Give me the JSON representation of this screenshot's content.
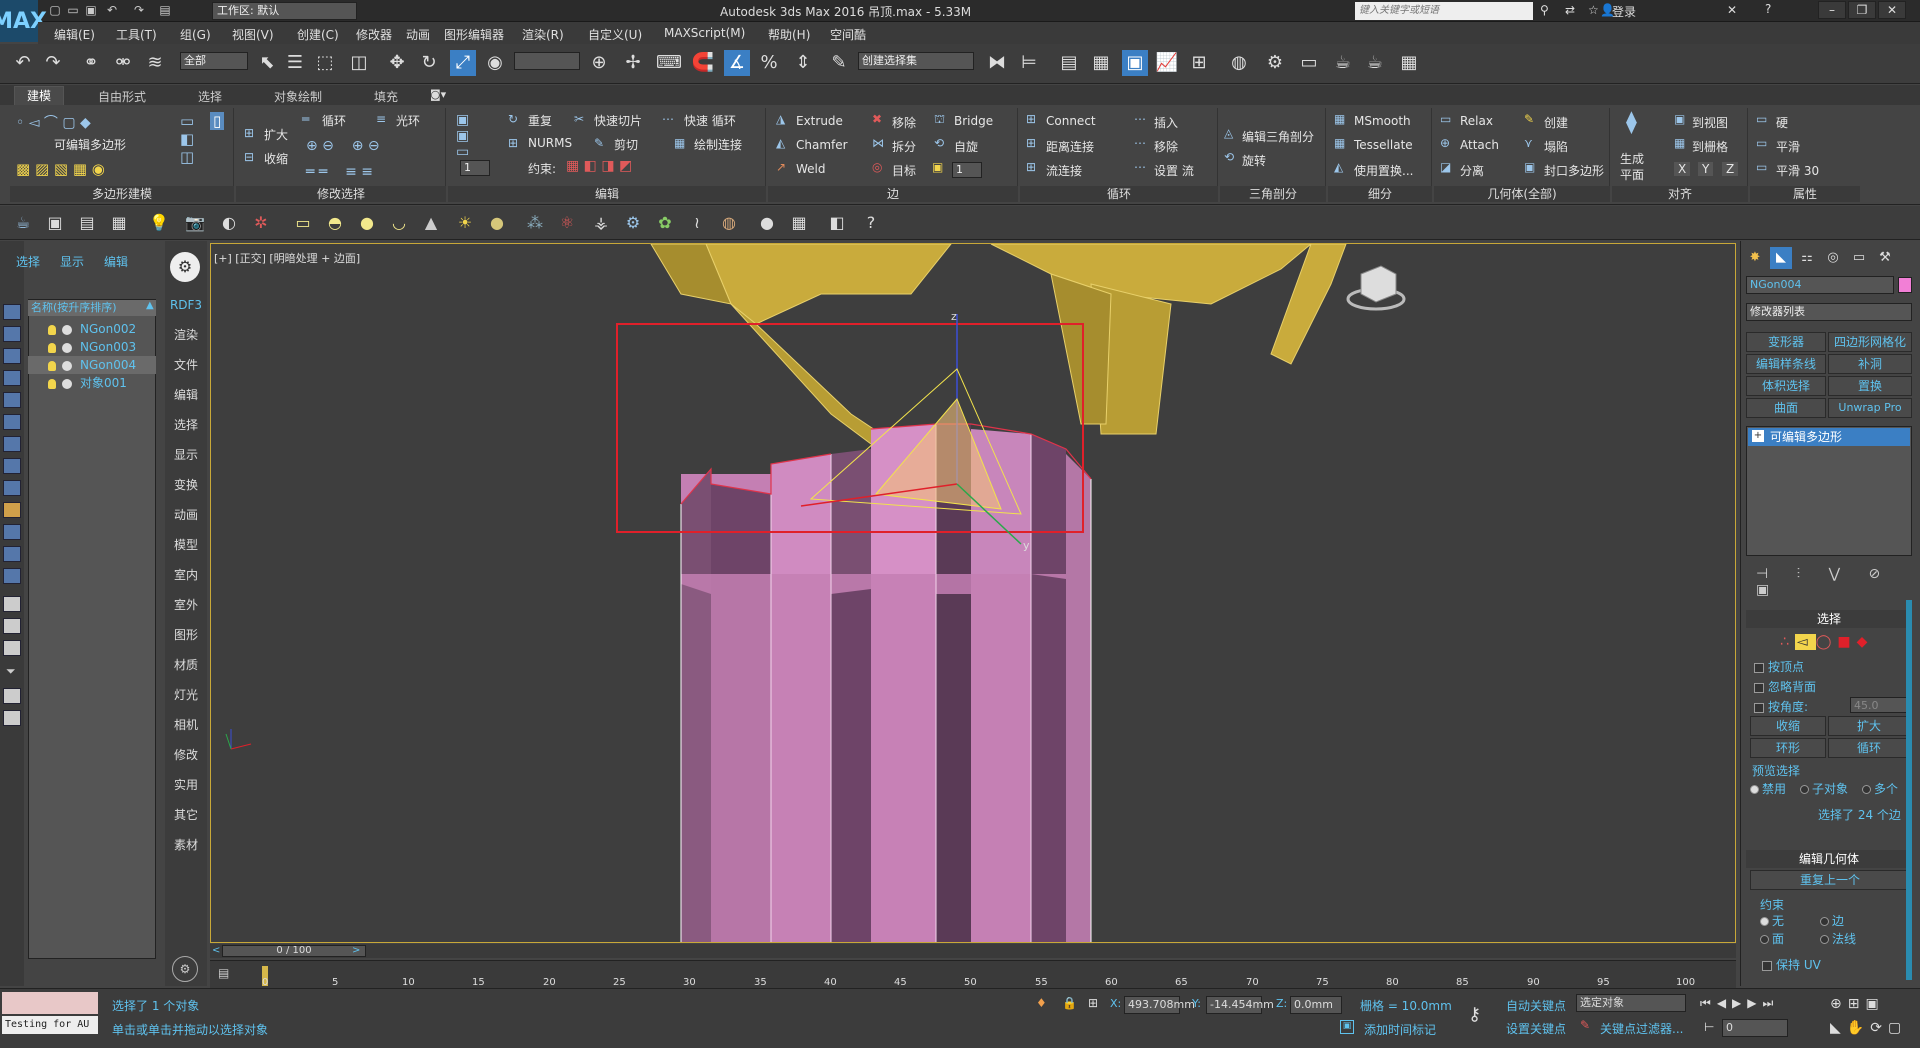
{
  "app": {
    "title": "Autodesk 3ds Max 2016     吊顶.max - 5.33M",
    "logo": "MAX",
    "workspace": "工作区: 默认",
    "search_placeholder": "键入关键字或短语",
    "login": "登录"
  },
  "menu": [
    "编辑(E)",
    "工具(T)",
    "组(G)",
    "视图(V)",
    "创建(C)",
    "修改器",
    "动画",
    "图形编辑器",
    "渲染(R)",
    "自定义(U)",
    "MAXScript(M)",
    "帮助(H)",
    "空间酷"
  ],
  "toolbar": {
    "filter_select": "全部",
    "named_selection": "创建选择集"
  },
  "ribbon_tabs": [
    "建模",
    "自由形式",
    "选择",
    "对象绘制",
    "填充"
  ],
  "ribbon": {
    "poly_label": "可编辑多边形",
    "group_labels": [
      "多边形建模",
      "修改选择",
      "编辑",
      "边",
      "循环",
      "三角剖分",
      "细分",
      "几何体(全部)",
      "对齐",
      "属性"
    ],
    "modify_sel": [
      "扩大",
      "收缩",
      "循环",
      "光环"
    ],
    "edit": [
      "重复",
      "快速切片",
      "快速 循环",
      "NURMS",
      "剪切",
      "绘制连接",
      "约束:"
    ],
    "edge_tools": [
      "Extrude",
      "移除",
      "Bridge",
      "Chamfer",
      "拆分",
      "自旋",
      "Weld",
      "目标"
    ],
    "loops": [
      "Connect",
      "插入",
      "距离连接",
      "移除",
      "流连接",
      "设置 流"
    ],
    "tri": [
      "编辑三角剖分",
      "旋转"
    ],
    "subdiv": [
      "MSmooth",
      "Tessellate",
      "使用置换..."
    ],
    "geom": [
      "Relax",
      "创建",
      "Attach",
      "塌陷",
      "分离",
      "封口多边形"
    ],
    "align": [
      "生成",
      "平面",
      "到视图",
      "到栅格",
      "X",
      "Y",
      "Z"
    ],
    "props": [
      "硬",
      "平滑",
      "平滑 30"
    ],
    "spinner": "1"
  },
  "scene": {
    "tabs": [
      "选择",
      "显示",
      "编辑"
    ],
    "list_header": "名称(按升序排序)",
    "items": [
      "NGon002",
      "NGon003",
      "NGon004",
      "对象001"
    ]
  },
  "vertical_bar": [
    "RDF3",
    "渲染",
    "文件",
    "编辑",
    "选择",
    "显示",
    "变换",
    "动画",
    "模型",
    "室内",
    "室外",
    "图形",
    "材质",
    "灯光",
    "相机",
    "修改",
    "实用",
    "其它",
    "素材"
  ],
  "viewport": {
    "label": "[+] [正交] [明暗处理 + 边面]",
    "gizmo_z": "z",
    "gizmo_y": "y"
  },
  "timeline": {
    "slider": "0 / 100",
    "ticks": [
      "0",
      "5",
      "10",
      "15",
      "20",
      "25",
      "30",
      "35",
      "40",
      "45",
      "50",
      "55",
      "60",
      "65",
      "70",
      "75",
      "80",
      "85",
      "90",
      "95",
      "100"
    ]
  },
  "command_panel": {
    "object_name": "NGon004",
    "object_color": "#f27fd6",
    "modifier_list": "修改器列表",
    "mod_buttons": [
      "变形器",
      "四边形网格化",
      "编辑样条线",
      "补洞",
      "体积选择",
      "置换",
      "曲面",
      "Unwrap Pro"
    ],
    "stack_item": "可编辑多边形",
    "selection": {
      "title": "选择",
      "by_vertex": "按顶点",
      "ignore_back": "忽略背面",
      "by_angle": "按角度:",
      "angle_value": "45.0",
      "shrink": "收缩",
      "grow": "扩大",
      "ring": "环形",
      "loop": "循环",
      "preview_title": "预览选择",
      "preview_opts": [
        "禁用",
        "子对象",
        "多个"
      ],
      "info": "选择了 24 个边"
    },
    "edit_geom": {
      "title": "编辑几何体",
      "repeat": "重复上一个",
      "constraint_title": "约束",
      "constraints": [
        "无",
        "边",
        "面",
        "法线"
      ],
      "keep_uv": "保持 UV"
    }
  },
  "status": {
    "maxscript_label": "Testing for AU",
    "selected": "选择了 1 个对象",
    "hint": "单击或单击并拖动以选择对象",
    "x_label": "X:",
    "x": "493.708mm",
    "y_label": "Y:",
    "y": "-14.454mm",
    "z_label": "Z:",
    "z": "0.0mm",
    "grid": "栅格 = 10.0mm",
    "auto_key": "自动关键点",
    "set_key": "设置关键点",
    "selected_obj": "选定对象",
    "key_filter": "关键点过滤器...",
    "add_time_tag": "添加时间标记",
    "frame": "0"
  }
}
